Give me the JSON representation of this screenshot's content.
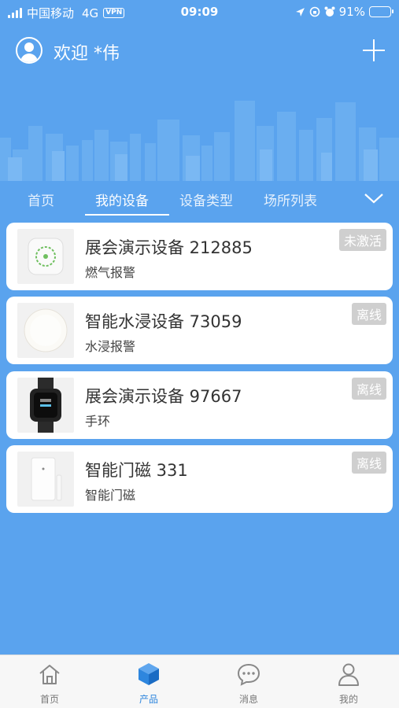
{
  "status_bar": {
    "carrier": "中国移动",
    "network": "4G",
    "vpn": "VPN",
    "time": "09:09",
    "battery": "91%",
    "battery_level": 0.91
  },
  "header": {
    "welcome": "欢迎 *伟",
    "avatar_icon": "user-avatar-icon",
    "add_icon": "plus-icon"
  },
  "tabs": [
    "首页",
    "我的设备",
    "设备类型",
    "场所列表"
  ],
  "active_tab": "我的设备",
  "devices": [
    {
      "name": "展会演示设备 212885",
      "type": "燃气报警",
      "status": "未激活",
      "image": "gas-detector-icon"
    },
    {
      "name": "智能水浸设备 73059",
      "type": "水浸报警",
      "status": "离线",
      "image": "water-sensor-icon"
    },
    {
      "name": "展会演示设备 97667",
      "type": "手环",
      "status": "离线",
      "image": "smart-band-icon"
    },
    {
      "name": "智能门磁 331",
      "type": "智能门磁",
      "status": "离线",
      "image": "door-sensor-icon"
    }
  ],
  "bottom_nav": [
    {
      "label": "首页",
      "icon": "home-icon"
    },
    {
      "label": "产品",
      "icon": "cube-icon"
    },
    {
      "label": "消息",
      "icon": "message-icon"
    },
    {
      "label": "我的",
      "icon": "profile-icon"
    }
  ],
  "colors": {
    "background": "#5aa3ee",
    "accent": "#2e86de",
    "badge": "#cfcfcf",
    "card": "#ffffff"
  }
}
